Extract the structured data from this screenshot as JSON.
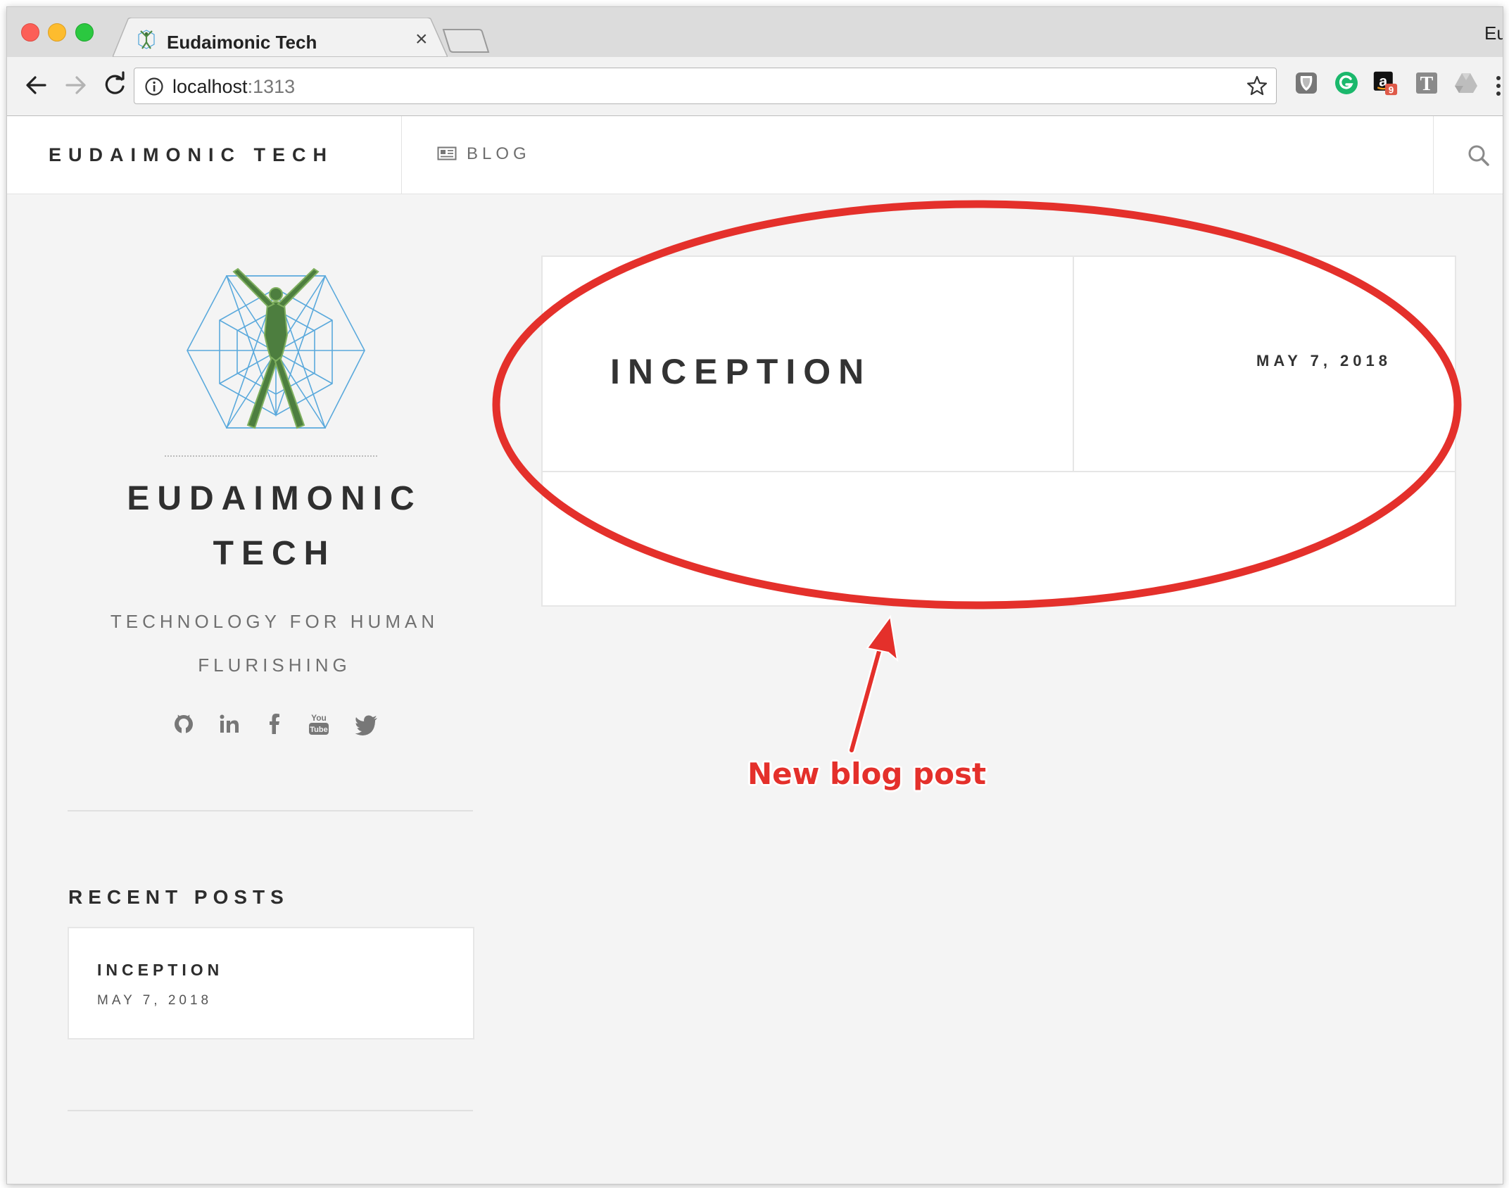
{
  "browser": {
    "tab_title": "Eudaimonic Tech",
    "tab_close_glyph": "×",
    "overflow_tab_text": "Eu",
    "url_host": "localhost",
    "url_port": ":1313",
    "extensions": [
      "shield-extension-icon",
      "grammarly-icon",
      "amazon-assistant-icon",
      "text-t-icon",
      "google-drive-icon"
    ],
    "amazon_badge": "9"
  },
  "site": {
    "brand": "EUDAIMONIC TECH",
    "nav": {
      "blog_label": "BLOG"
    }
  },
  "sidebar": {
    "title_line1": "EUDAIMONIC",
    "title_line2": "TECH",
    "tagline_line1": "TECHNOLOGY FOR HUMAN",
    "tagline_line2": "FLURISHING",
    "social_icons": [
      "github-icon",
      "linkedin-icon",
      "facebook-icon",
      "youtube-icon",
      "twitter-icon"
    ],
    "youtube_you": "You",
    "youtube_tube": "Tube",
    "recent_posts_heading": "RECENT POSTS",
    "recent_posts": [
      {
        "title": "INCEPTION",
        "date": "MAY 7, 2018"
      }
    ]
  },
  "main": {
    "post": {
      "title": "INCEPTION",
      "date": "MAY 7, 2018"
    }
  },
  "annotation": {
    "label": "New blog post",
    "color": "#e4302b"
  }
}
